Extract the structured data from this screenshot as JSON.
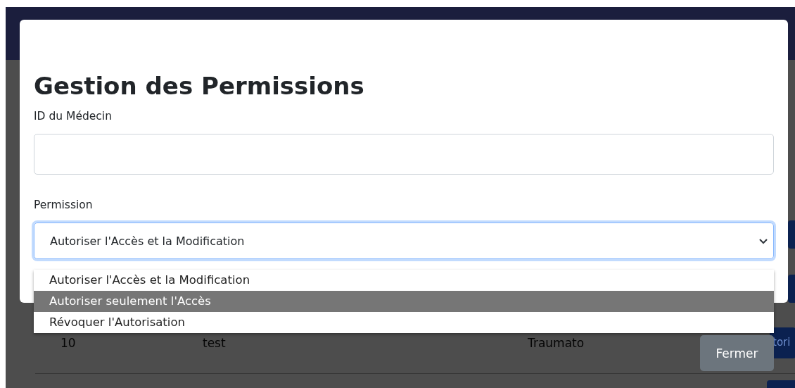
{
  "background_page": {
    "table_row": {
      "id": "10",
      "name": "test",
      "specialty": "Traumato",
      "action": "tori"
    }
  },
  "modal": {
    "title": "Gestion des Permissions",
    "doctor_id": {
      "label": "ID du Médecin"
    },
    "permission": {
      "label": "Permission",
      "value": "Autoriser l'Accès et la Modification",
      "expanded": true,
      "options": [
        {
          "label": "Autoriser l'Accès et la Modification",
          "highlighted": false
        },
        {
          "label": "Autoriser seulement l'Accès",
          "highlighted": true
        },
        {
          "label": "Révoquer l'Autorisation",
          "highlighted": false
        }
      ]
    },
    "close_button": "Fermer"
  }
}
